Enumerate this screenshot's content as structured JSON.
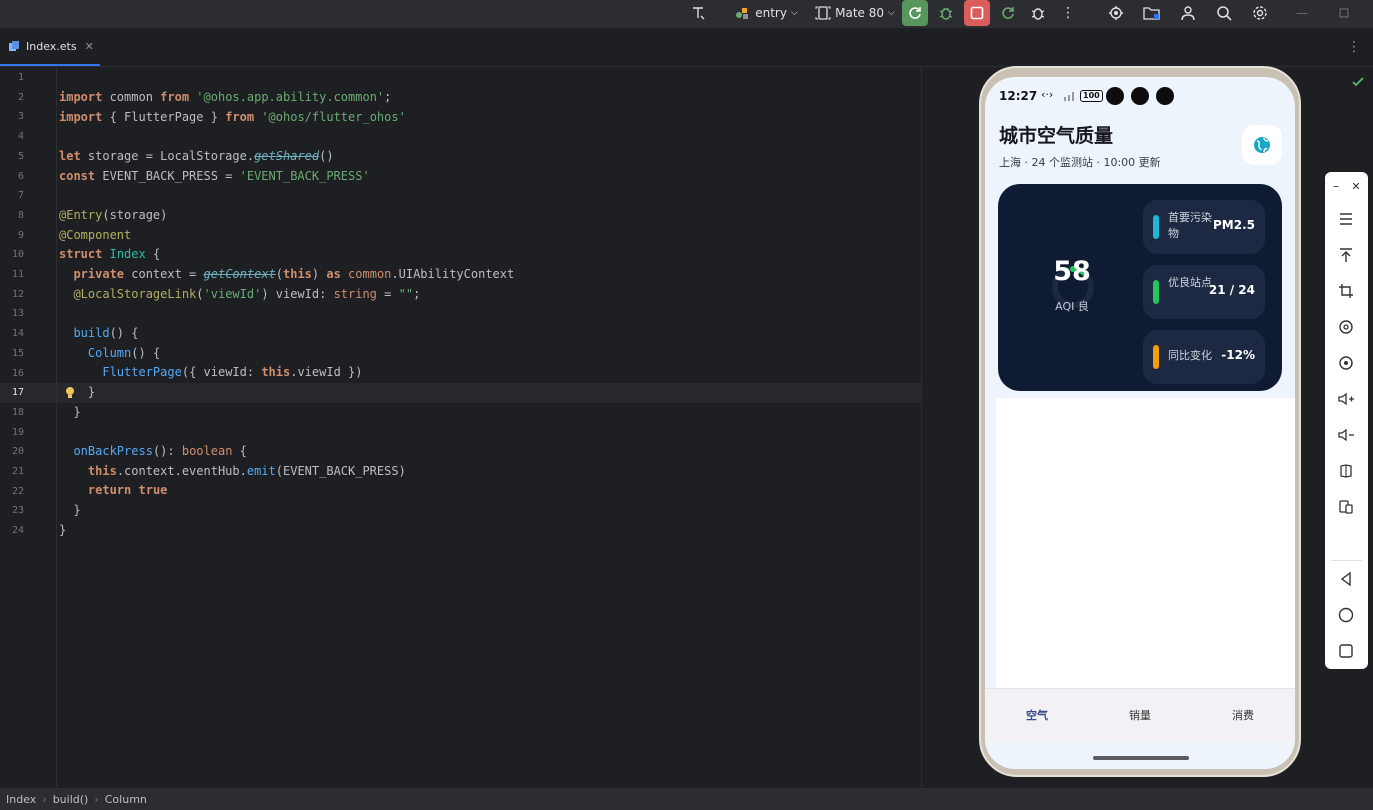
{
  "toolbar": {
    "run_config": "entry",
    "device": "Mate 80"
  },
  "editor": {
    "tab_name": "Index.ets",
    "current_line": 17,
    "line_numbers": [
      "1",
      "2",
      "3",
      "4",
      "5",
      "6",
      "7",
      "8",
      "9",
      "10",
      "11",
      "12",
      "13",
      "14",
      "15",
      "16",
      "17",
      "18",
      "19",
      "20",
      "21",
      "22",
      "23",
      "24"
    ]
  },
  "statusbar": {
    "crumbs": [
      "Index",
      "build()",
      "Column"
    ]
  },
  "phone": {
    "time": "12:27",
    "battery": "100",
    "title": "城市空气质量",
    "subtitle": "上海 · 24 个监测站 · 10:00 更新",
    "aqi": {
      "value": "58",
      "label": "AQI 良",
      "ring_progress": 0.12
    },
    "stats": [
      {
        "label": "首要污染物",
        "value": "PM2.5",
        "color": "#1bb7d4"
      },
      {
        "label": "优良站点",
        "value": "21 / 24",
        "color": "#22c55e"
      },
      {
        "label": "同比变化",
        "value": "-12%",
        "color": "#f59e0b"
      }
    ],
    "nav": [
      {
        "label": "空气",
        "active": true
      },
      {
        "label": "销量",
        "active": false
      },
      {
        "label": "消费",
        "active": false
      }
    ]
  },
  "colors": {
    "ide_bg": "#1e1f22",
    "card_bg": "#0f1a33",
    "active_nav": "#3d4a8a"
  }
}
